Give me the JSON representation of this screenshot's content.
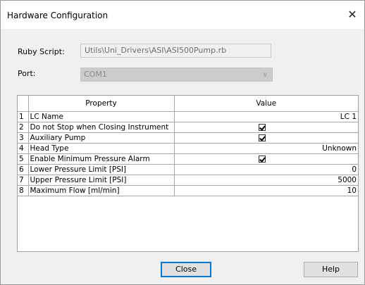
{
  "window": {
    "title": "Hardware Configuration",
    "close_glyph": "✕"
  },
  "form": {
    "script_label": "Ruby Script:",
    "script_value": "Utils\\Uni_Drivers\\ASI\\ASI500Pump.rb",
    "port_label": "Port:",
    "port_value": "COM1",
    "port_icon": "chevron-down-icon"
  },
  "table": {
    "headers": [
      "",
      "Property",
      "Value"
    ],
    "rows": [
      {
        "num": "1",
        "property": "LC Name",
        "value": "LC 1",
        "type": "text"
      },
      {
        "num": "2",
        "property": "Do not Stop when Closing Instrument",
        "value": "true",
        "type": "checkbox"
      },
      {
        "num": "3",
        "property": "Auxiliary Pump",
        "value": "true",
        "type": "checkbox"
      },
      {
        "num": "4",
        "property": "Head Type",
        "value": "Unknown",
        "type": "text"
      },
      {
        "num": "5",
        "property": "Enable Minimum Pressure Alarm",
        "value": "true",
        "type": "checkbox"
      },
      {
        "num": "6",
        "property": "Lower Pressure Limit [PSI]",
        "value": "0",
        "type": "text"
      },
      {
        "num": "7",
        "property": "Upper Pressure Limit [PSI]",
        "value": "5000",
        "type": "text"
      },
      {
        "num": "8",
        "property": "Maximum Flow [ml/min]",
        "value": "10",
        "type": "text"
      }
    ]
  },
  "buttons": {
    "close_label": "Close",
    "help_label": "Help"
  },
  "colors": {
    "focus_border": "#0078d7",
    "dialog_bg": "#f0f0f0"
  }
}
